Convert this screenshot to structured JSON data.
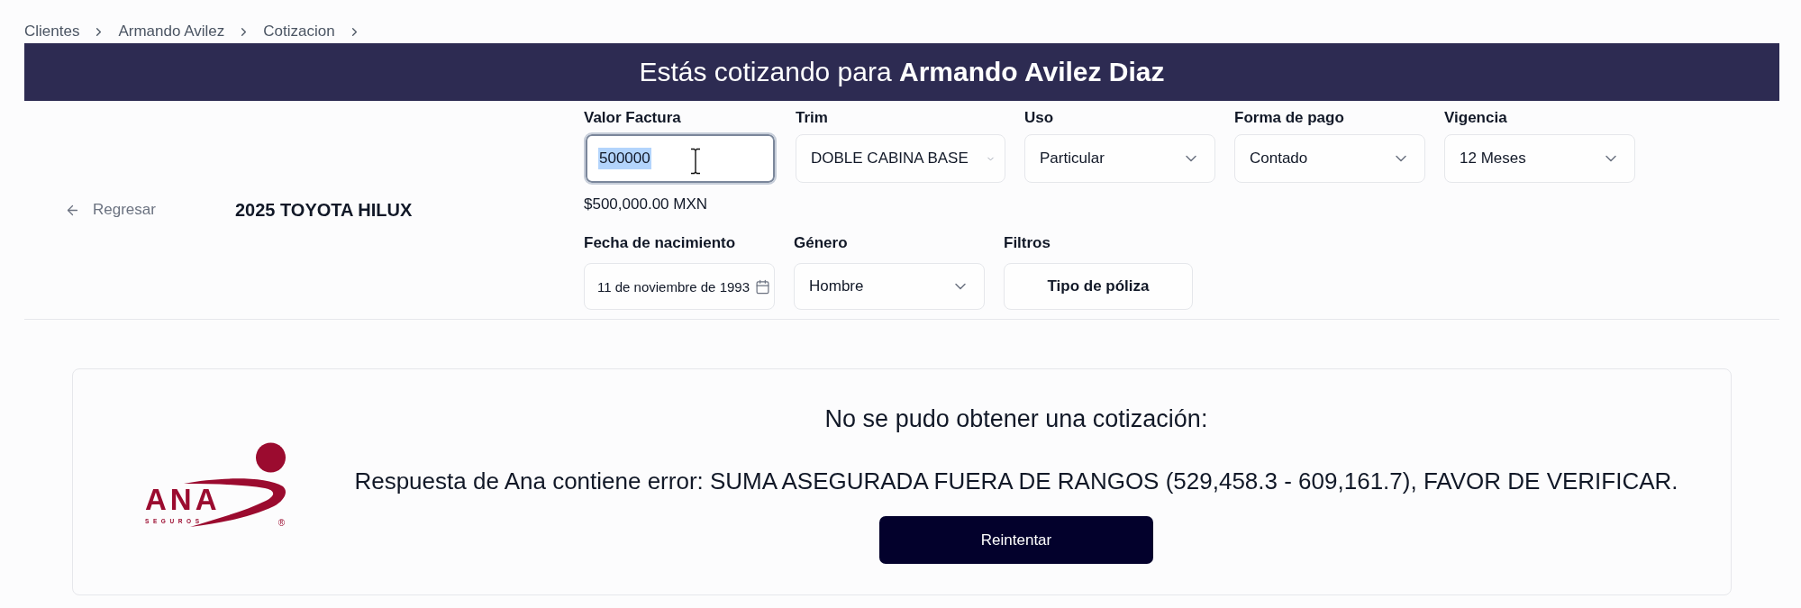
{
  "breadcrumb": [
    {
      "label": "Clientes"
    },
    {
      "label": "Armando Avilez"
    },
    {
      "label": "Cotizacion"
    }
  ],
  "banner": {
    "text": "Estás cotizando para **Armando Avilez Diaz**"
  },
  "header": {
    "back_link": "Regresar",
    "vehicle": "2025 TOYOTA HILUX"
  },
  "form": {
    "rows": [
      [
        {
          "kind": "input",
          "label": "Valor Factura",
          "value": "500000",
          "focused": true,
          "value_selected": true,
          "hint": "$500,000.00 MXN"
        },
        {
          "kind": "native-select",
          "label": "Trim",
          "value": "DOBLE CABINA BASE"
        },
        {
          "kind": "select",
          "label": "Uso",
          "value": "Particular"
        },
        {
          "kind": "select",
          "label": "Forma de pago",
          "value": "Contado"
        },
        {
          "kind": "select",
          "label": "Vigencia",
          "value": "12 Meses"
        }
      ],
      [
        {
          "kind": "date",
          "label": "Fecha de nacimiento",
          "value": "11 de noviembre de 1993"
        },
        {
          "kind": "select",
          "label": "Género",
          "value": "Hombre"
        },
        {
          "kind": "button",
          "label": "Filtros",
          "value": "Tipo de póliza"
        }
      ]
    ]
  },
  "quote_error": {
    "logo": {
      "wordmark": "ANA",
      "tagline": "SEGUROS",
      "registered": "®"
    },
    "title": "No se pudo obtener una cotización:",
    "message": "Respuesta de Ana contiene error: SUMA ASEGURADA FUERA DE RANGOS (529,458.3 - 609,161.7), FAVOR DE VERIFICAR.",
    "retry_button": "Reintentar"
  }
}
